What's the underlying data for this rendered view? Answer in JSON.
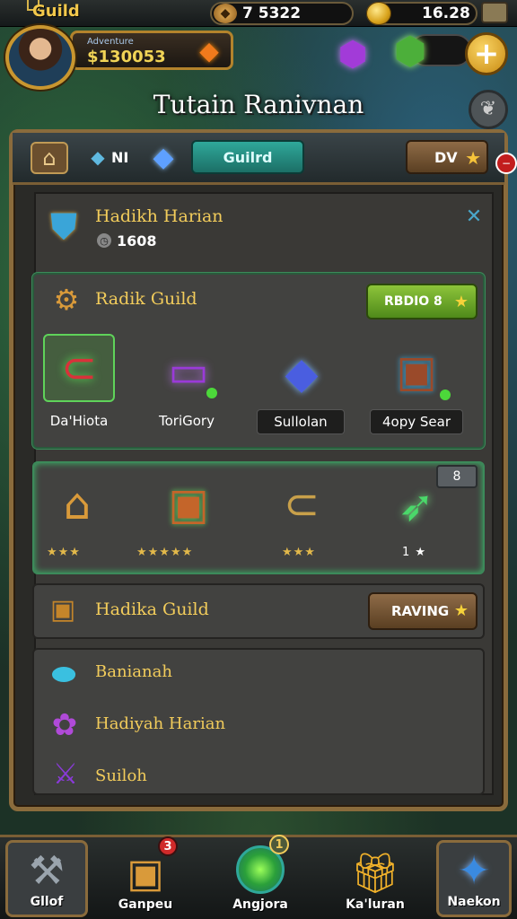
{
  "topbar": {
    "guild_label": "Guild",
    "resource_1": {
      "value": "7 5322",
      "icon": "ore-icon"
    },
    "resource_2": {
      "value": "16.28",
      "icon": "gold-coin-icon"
    }
  },
  "profile": {
    "subtitle": "Adventure",
    "money": "$130053",
    "icons": [
      "fire-gem-icon",
      "purple-gem-icon",
      "green-gem-icon",
      "plus-icon"
    ]
  },
  "page_title": "Tutain Ranivnan",
  "tabs": {
    "stat_label": "NI",
    "guild_tab": "Guilrd",
    "dv_tab": "DV"
  },
  "daily": {
    "title": "Hadikh Harian",
    "value": "1608"
  },
  "guild_section": {
    "title": "Radik Guild",
    "button": "RBDIO 8",
    "items": [
      {
        "label": "Da'Hiota",
        "icon": "magnet-icon"
      },
      {
        "label": "ToriGory",
        "icon": "scroll-icon"
      },
      {
        "label": "Sullolan",
        "icon": "crystal-icon"
      },
      {
        "label": "4opy Sear",
        "icon": "chest-icon"
      }
    ]
  },
  "rewards": {
    "tag": "8",
    "items": [
      {
        "icon": "lantern-icon",
        "stars": "★★★"
      },
      {
        "icon": "treasure-chest-icon",
        "stars": "★★★★★"
      },
      {
        "icon": "magnet-icon",
        "stars": "★★★"
      },
      {
        "icon": "feather-icon",
        "stars": "1 ★"
      }
    ]
  },
  "hadika": {
    "title": "Hadika Guild",
    "button": "RAVING"
  },
  "list": [
    {
      "icon": "bandage-icon",
      "label": "Banianah"
    },
    {
      "icon": "flower-icon",
      "label": "Hadiyah Harian"
    },
    {
      "icon": "sword-icon",
      "label": "Suiloh"
    }
  ],
  "nav": [
    {
      "label": "Gllof",
      "icon": "hammer-icon",
      "badge": ""
    },
    {
      "label": "Ganpeu",
      "icon": "chest-icon",
      "badge": "3"
    },
    {
      "label": "Angjora",
      "icon": "orb-icon",
      "badge": "1"
    },
    {
      "label": "Ka'luran",
      "icon": "gift-icon",
      "badge": ""
    },
    {
      "label": "Naekon",
      "icon": "star-crystal-icon",
      "badge": ""
    }
  ],
  "colors": {
    "accent": "#2fa89a",
    "gold": "#f2cc5b",
    "frame": "#8a6b3c",
    "green": "#6ac92a"
  }
}
